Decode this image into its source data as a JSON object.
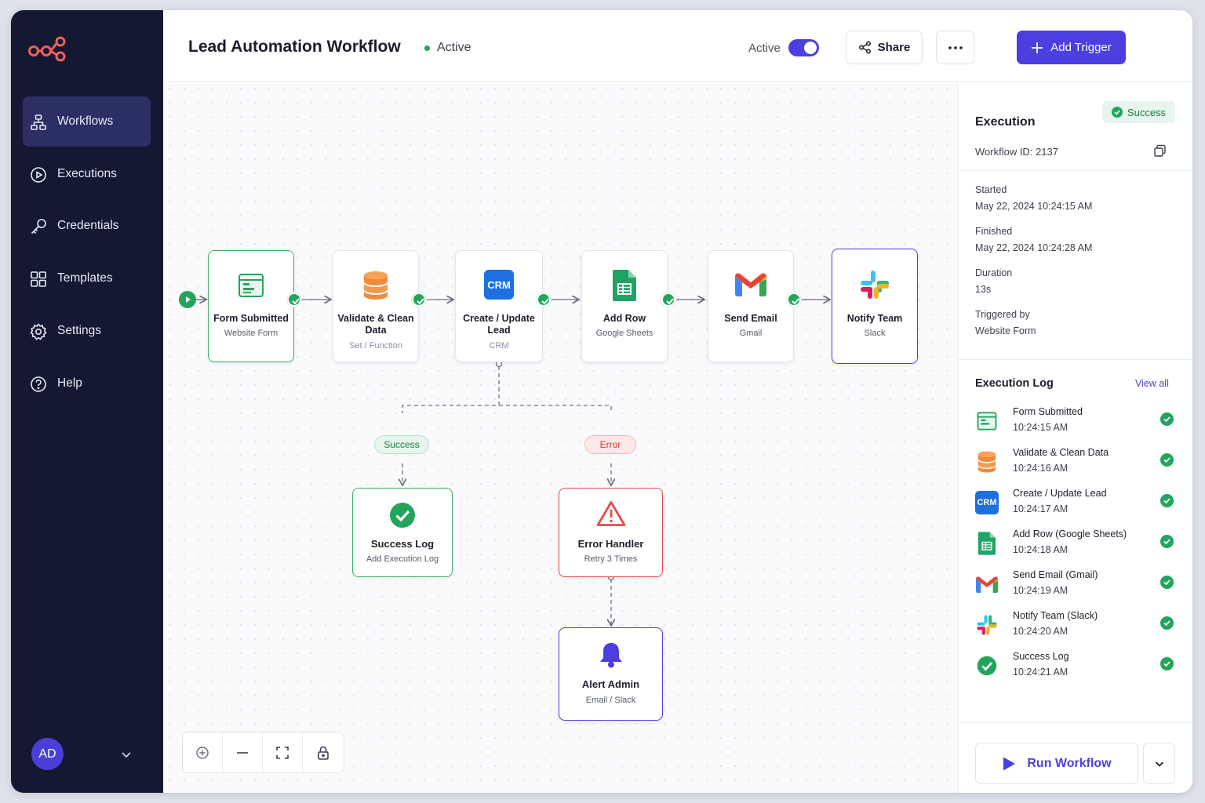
{
  "header": {
    "title": "Lead Automation Workflow",
    "status": "Active",
    "toggle_label": "Active",
    "toggle_on": true,
    "share_label": "Share",
    "add_trigger_label": "Add Trigger"
  },
  "sidebar": {
    "items": [
      {
        "label": "Workflows",
        "icon": "workflow-icon",
        "active": true
      },
      {
        "label": "Executions",
        "icon": "play-circle-icon",
        "active": false
      },
      {
        "label": "Credentials",
        "icon": "key-icon",
        "active": false
      },
      {
        "label": "Templates",
        "icon": "grid-icon",
        "active": false
      },
      {
        "label": "Settings",
        "icon": "gear-icon",
        "active": false
      },
      {
        "label": "Help",
        "icon": "help-icon",
        "active": false
      }
    ],
    "user_initials": "AD"
  },
  "workflow": {
    "nodes": [
      {
        "title": "Form Submitted",
        "subtitle": "Website Form",
        "icon": "form-icon"
      },
      {
        "title": "Validate & Clean Data",
        "subtitle": "Set / Function",
        "icon": "database-icon"
      },
      {
        "title": "Create / Update Lead",
        "subtitle": "CRM",
        "icon": "crm-icon",
        "icon_text": "CRM"
      },
      {
        "title": "Add Row",
        "subtitle": "Google Sheets",
        "icon": "sheets-icon"
      },
      {
        "title": "Send Email",
        "subtitle": "Gmail",
        "icon": "gmail-icon"
      },
      {
        "title": "Notify Team",
        "subtitle": "Slack",
        "icon": "slack-icon"
      }
    ],
    "branches": {
      "success_label": "Success",
      "error_label": "Error"
    },
    "success_node": {
      "title": "Success Log",
      "subtitle": "Add Execution Log",
      "icon": "check-circle-icon"
    },
    "error_node": {
      "title": "Error Handler",
      "subtitle": "Retry 3 Times",
      "icon": "warning-icon"
    },
    "alert_node": {
      "title": "Alert Admin",
      "subtitle": "Email / Slack",
      "icon": "bell-icon"
    }
  },
  "execution": {
    "title": "Execution",
    "status": "Success",
    "workflow_id_label": "Workflow ID:",
    "workflow_id": "2137",
    "started_label": "Started",
    "started": "May 22, 2024  10:24:15 AM",
    "finished_label": "Finished",
    "finished": "May 22, 2024  10:24:28 AM",
    "duration_label": "Duration",
    "duration": "13s",
    "triggered_label": "Triggered by",
    "triggered_by": "Website Form"
  },
  "log": {
    "title": "Execution Log",
    "view_all": "View all",
    "items": [
      {
        "name": "Form Submitted",
        "time": "10:24:15 AM",
        "icon": "form-icon"
      },
      {
        "name": "Validate & Clean Data",
        "time": "10:24:16 AM",
        "icon": "database-icon"
      },
      {
        "name": "Create / Update Lead",
        "time": "10:24:17 AM",
        "icon": "crm-icon"
      },
      {
        "name": "Add Row (Google Sheets)",
        "time": "10:24:18 AM",
        "icon": "sheets-icon"
      },
      {
        "name": "Send Email (Gmail)",
        "time": "10:24:19 AM",
        "icon": "gmail-icon"
      },
      {
        "name": "Notify Team (Slack)",
        "time": "10:24:20 AM",
        "icon": "slack-icon"
      },
      {
        "name": "Success Log",
        "time": "10:24:21 AM",
        "icon": "check-circle-icon"
      }
    ]
  },
  "run_label": "Run Workflow",
  "colors": {
    "sidebar_bg": "#141832",
    "accent": "#4b3fe0",
    "success": "#22a55b",
    "error": "#e64b4b"
  }
}
